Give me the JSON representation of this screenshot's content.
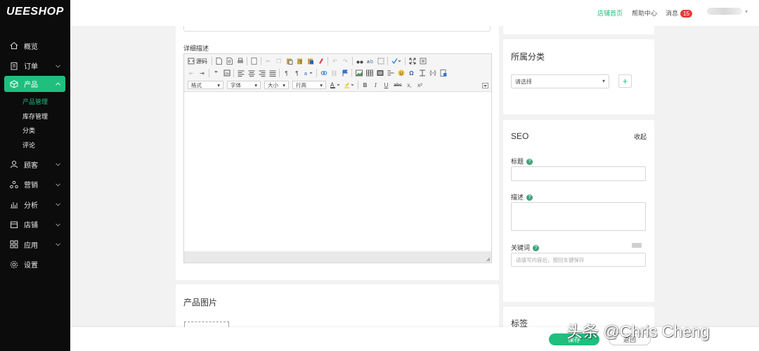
{
  "brand": {
    "logo": "UEESHOP",
    "accent": "#1fbf7e"
  },
  "topbar": {
    "home": "店铺首页",
    "help": "帮助中心",
    "messages": "消息",
    "message_count": "15"
  },
  "sidebar": {
    "items": [
      {
        "label": "概览",
        "icon": "home-icon"
      },
      {
        "label": "订单",
        "icon": "order-icon"
      },
      {
        "label": "产品",
        "icon": "box-icon",
        "active": true
      },
      {
        "label": "顾客",
        "icon": "user-icon"
      },
      {
        "label": "营销",
        "icon": "marketing-icon"
      },
      {
        "label": "分析",
        "icon": "chart-icon"
      },
      {
        "label": "店铺",
        "icon": "store-icon"
      },
      {
        "label": "应用",
        "icon": "apps-icon"
      },
      {
        "label": "设置",
        "icon": "gear-icon"
      }
    ],
    "product_sub": [
      "产品管理",
      "库存管理",
      "分类",
      "评论"
    ]
  },
  "editor": {
    "label": "详细描述",
    "source": "源码",
    "format": "格式",
    "font": "字体",
    "size": "大小",
    "line_height": "行高",
    "bold": "B",
    "italic": "I",
    "underline": "U",
    "strike": "abc",
    "sub": "x,",
    "sup": "x²"
  },
  "images": {
    "title": "产品图片"
  },
  "category": {
    "title": "所属分类",
    "placeholder": "请选择"
  },
  "seo": {
    "title": "SEO",
    "collapse": "收起",
    "title_label": "标题",
    "desc_label": "描述",
    "keywords_label": "关键词",
    "keywords_placeholder": "请填写内容后，按回车键保存"
  },
  "tags": {
    "title": "标签"
  },
  "footer": {
    "save": "保存",
    "back": "返回"
  },
  "watermark": "头条 @Chris Cheng"
}
